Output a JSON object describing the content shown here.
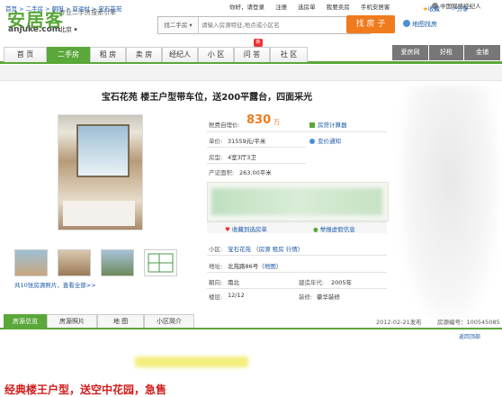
{
  "header": {
    "logo_cn": "安居客",
    "logo_en": "anjuke.com",
    "slogan": "专业二手房搜索引擎",
    "city": "北京",
    "city_arrow": "▾",
    "top_links": [
      "你好，请登录",
      "注册",
      "选房单",
      "我要卖房",
      "手机安居客"
    ],
    "top_right": "中国网络经纪人",
    "search_category": "找二手房 ▾",
    "search_placeholder": "请输入房源特征,地点或小区名",
    "search_button": "找 房 子",
    "map_link": "地图找房"
  },
  "nav": {
    "items": [
      "首 页",
      "二手房",
      "租 房",
      "卖 房",
      "经纪人",
      "小 区",
      "问 答",
      "社 区"
    ],
    "active": "二手房",
    "new_badge": "新",
    "right_tabs": [
      "爱房网",
      "好租",
      "金铺"
    ]
  },
  "breadcrumb": "首页 > 二手房 > 朝阳 > 亚运村 > 宝石花苑",
  "fav": "收藏",
  "share": "分享",
  "listing": {
    "title": "宝石花苑 楼王户型带车位，送200平露台，四面采光",
    "price_label": "税费自理价:",
    "price": "830",
    "price_unit": "万",
    "unit_price_label": "单价:",
    "unit_price": "31559元/平米",
    "layout_label": "房型:",
    "layout": "4室3厅3卫",
    "area_label": "产证面积:",
    "area": "263.00平米",
    "calc_link": "房贷计算器",
    "price_alert": "变价通知",
    "save_link": "收藏到选房单",
    "report_link": "举报虚假信息",
    "community_label": "小区:",
    "community": "宝石花苑",
    "community_links": [
      "房源",
      "租房",
      "行情"
    ],
    "address_label": "地址:",
    "address": "北苑路86号",
    "map": "地图",
    "facing_label": "朝向:",
    "facing": "南北",
    "year_label": "建造年代:",
    "year": "2005年",
    "floor_label": "楼层:",
    "floor": "12/12",
    "decor_label": "装修:",
    "decor": "豪华装修",
    "photos_link": "共10张房源照片，查看全部>>"
  },
  "tabs": [
    "房源总览",
    "房源照片",
    "地 图",
    "小区简介"
  ],
  "active_tab": "房源总览",
  "pub_date": "2012-02-21发布",
  "house_id": "房源编号：100545085",
  "report": "返回顶部",
  "desc_title": "经典楼王户型，送空中花园，急售"
}
